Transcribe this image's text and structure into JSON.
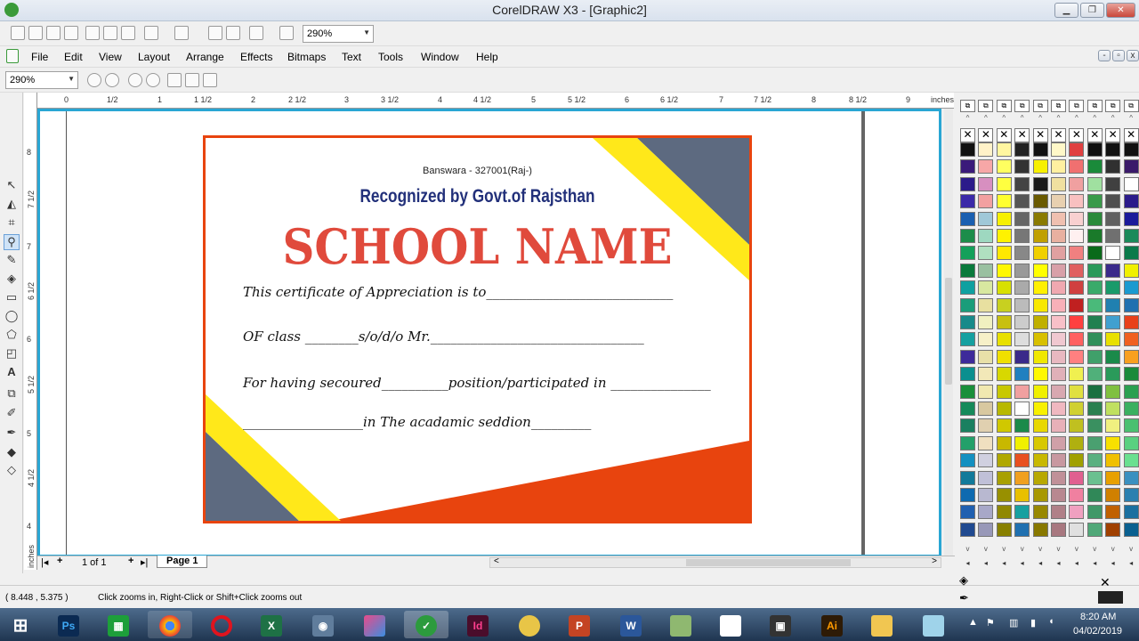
{
  "window": {
    "title": "CorelDRAW X3 - [Graphic2]"
  },
  "toolbar": {
    "zoom_value": "290%"
  },
  "menu": [
    "File",
    "Edit",
    "View",
    "Layout",
    "Arrange",
    "Effects",
    "Bitmaps",
    "Text",
    "Tools",
    "Window",
    "Help"
  ],
  "zoombar": {
    "zoom_value": "290%"
  },
  "ruler": {
    "h_labels": [
      "0",
      "1/2",
      "1",
      "1 1/2",
      "2",
      "2 1/2",
      "3",
      "3 1/2",
      "4",
      "4 1/2",
      "5",
      "5 1/2",
      "6",
      "6 1/2",
      "7",
      "7 1/2",
      "8",
      "8 1/2",
      "9",
      "inches"
    ],
    "v_labels": [
      "8",
      "7 1/2",
      "7",
      "6 1/2",
      "6",
      "5 1/2",
      "5",
      "4 1/2",
      "4",
      "inches"
    ]
  },
  "certificate": {
    "address": "Banswara - 327001(Raj-)",
    "recognition": "Recognized by Govt.of Rajsthan",
    "school_name": "SCHOOL NAME",
    "line1": "This certificate of Appreciation is to____________________________",
    "line2": "OF class ________s/o/d/o Mr.________________________________",
    "line3": "For having secoured__________position/participated in _______________",
    "line4": "__________________in The acadamic seddion_________",
    "colors": {
      "border": "#e8440e",
      "slate": "#5d6a80",
      "stripe": "#ffe81a",
      "title_red": "#e04a3c",
      "subtitle_blue": "#22307a"
    }
  },
  "pagenav": {
    "page_count": "1 of 1",
    "page_tab": "Page 1"
  },
  "status": {
    "coords": "( 8.448 , 5.375 )",
    "hint": "Click zooms in, Right-Click or Shift+Click zooms out"
  },
  "taskbar": {
    "apps": [
      {
        "icon": "windows-icon",
        "label": ""
      },
      {
        "icon": "photoshop-icon",
        "label": "Ps"
      },
      {
        "icon": "store-icon",
        "label": ""
      },
      {
        "icon": "chrome-icon",
        "label": ""
      },
      {
        "icon": "opera-icon",
        "label": ""
      },
      {
        "icon": "excel-icon",
        "label": "X"
      },
      {
        "icon": "camera-icon",
        "label": ""
      },
      {
        "icon": "coreldraw-icon",
        "label": ""
      },
      {
        "icon": "indesign-icon",
        "label": "Id"
      },
      {
        "icon": "powerpoint-icon",
        "label": "P"
      },
      {
        "icon": "word-icon",
        "label": "W"
      },
      {
        "icon": "illustrator-icon",
        "label": "Ai"
      }
    ],
    "time": "8:20 AM",
    "date": "04/02/2019"
  }
}
